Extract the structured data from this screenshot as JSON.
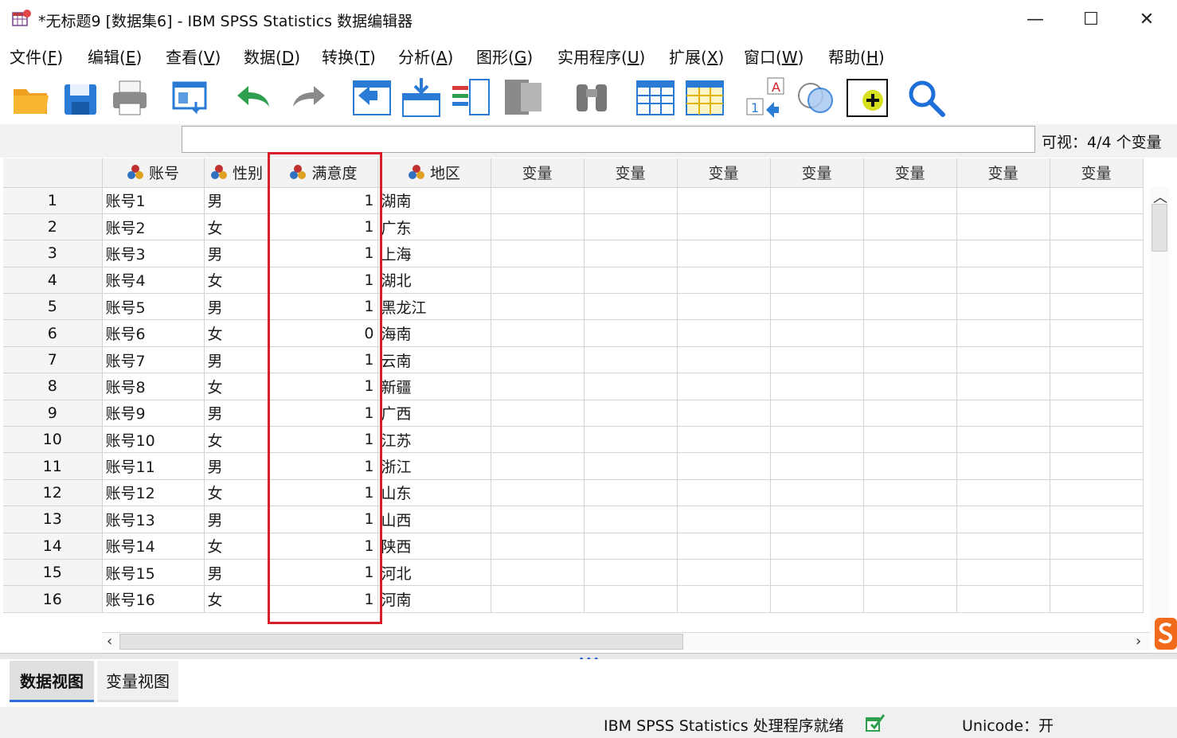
{
  "window": {
    "title": "*无标题9 [数据集6] - IBM SPSS Statistics 数据编辑器",
    "minimize": "—",
    "maximize": "☐",
    "close": "✕"
  },
  "menu": [
    {
      "label": "文件(",
      "key": "F",
      "tail": ")"
    },
    {
      "label": "编辑(",
      "key": "E",
      "tail": ")"
    },
    {
      "label": "查看(",
      "key": "V",
      "tail": ")"
    },
    {
      "label": "数据(",
      "key": "D",
      "tail": ")"
    },
    {
      "label": "转换(",
      "key": "T",
      "tail": ")"
    },
    {
      "label": "分析(",
      "key": "A",
      "tail": ")"
    },
    {
      "label": "图形(",
      "key": "G",
      "tail": ")"
    },
    {
      "label": "实用程序(",
      "key": "U",
      "tail": ")"
    },
    {
      "label": "扩展(",
      "key": "X",
      "tail": ")"
    },
    {
      "label": "窗口(",
      "key": "W",
      "tail": ")"
    },
    {
      "label": "帮助(",
      "key": "H",
      "tail": ")"
    }
  ],
  "toolbar": {
    "icons": [
      "open-folder-icon",
      "save-icon",
      "print-icon",
      "dialog-recall-icon",
      "undo-icon",
      "redo-icon",
      "goto-case-icon",
      "goto-variable-icon",
      "variables-icon",
      "run-descriptives-icon",
      "find-icon",
      "insert-cases-icon",
      "insert-variable-icon",
      "split-file-icon",
      "weight-cases-icon",
      "value-labels-icon",
      "use-sets-icon",
      "search-icon"
    ]
  },
  "cellbar": {
    "editor_value": "",
    "visible_label": "可视：4/4 个变量"
  },
  "grid": {
    "columns": [
      {
        "name": "账号",
        "type": "nominal",
        "align": "str"
      },
      {
        "name": "性别",
        "type": "nominal",
        "align": "str"
      },
      {
        "name": "满意度",
        "type": "nominal",
        "align": "num"
      },
      {
        "name": "地区",
        "type": "nominal",
        "align": "str"
      },
      {
        "name": "变量",
        "type": "empty"
      },
      {
        "name": "变量",
        "type": "empty"
      },
      {
        "name": "变量",
        "type": "empty"
      },
      {
        "name": "变量",
        "type": "empty"
      },
      {
        "name": "变量",
        "type": "empty"
      },
      {
        "name": "变量",
        "type": "empty"
      },
      {
        "name": "变量",
        "type": "empty"
      }
    ],
    "rows": [
      [
        "1",
        "账号1",
        "男",
        "1",
        "湖南"
      ],
      [
        "2",
        "账号2",
        "女",
        "1",
        "广东"
      ],
      [
        "3",
        "账号3",
        "男",
        "1",
        "上海"
      ],
      [
        "4",
        "账号4",
        "女",
        "1",
        "湖北"
      ],
      [
        "5",
        "账号5",
        "男",
        "1",
        "黑龙江"
      ],
      [
        "6",
        "账号6",
        "女",
        "0",
        "海南"
      ],
      [
        "7",
        "账号7",
        "男",
        "1",
        "云南"
      ],
      [
        "8",
        "账号8",
        "女",
        "1",
        "新疆"
      ],
      [
        "9",
        "账号9",
        "男",
        "1",
        "广西"
      ],
      [
        "10",
        "账号10",
        "女",
        "1",
        "江苏"
      ],
      [
        "11",
        "账号11",
        "男",
        "1",
        "浙江"
      ],
      [
        "12",
        "账号12",
        "女",
        "1",
        "山东"
      ],
      [
        "13",
        "账号13",
        "男",
        "1",
        "山西"
      ],
      [
        "14",
        "账号14",
        "女",
        "1",
        "陕西"
      ],
      [
        "15",
        "账号15",
        "男",
        "1",
        "河北"
      ],
      [
        "16",
        "账号16",
        "女",
        "1",
        "河南"
      ]
    ]
  },
  "tabs": {
    "data_view": "数据视图",
    "variable_view": "变量视图"
  },
  "status": {
    "processor": "IBM SPSS Statistics 处理程序就绪",
    "unicode": "Unicode：开"
  },
  "colors": {
    "highlight": "#d81e2a",
    "accent": "#2c6fd6"
  }
}
